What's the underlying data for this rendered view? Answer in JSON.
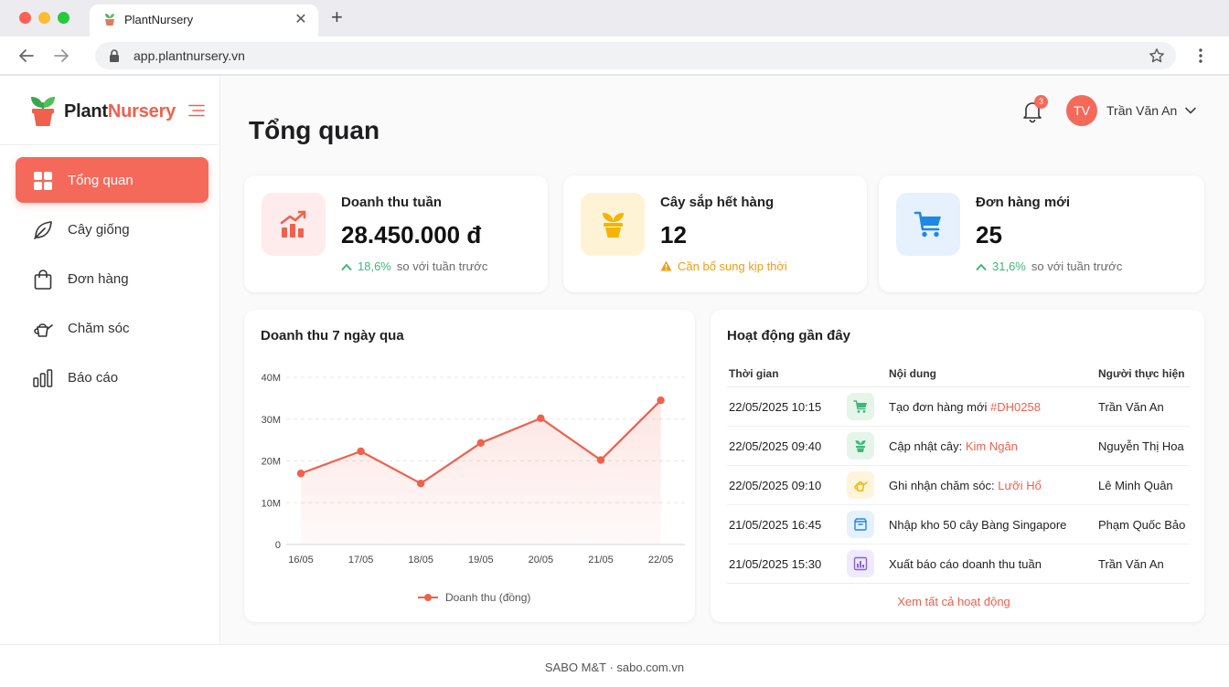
{
  "browser": {
    "tab_title": "PlantNursery",
    "url": "app.plantnursery.vn"
  },
  "brand": {
    "part1": "Plant",
    "part2": "Nursery",
    "accent_color": "#f0604d"
  },
  "sidebar": {
    "items": [
      {
        "label": "Tổng quan",
        "icon": "dashboard-grid-icon",
        "active": true
      },
      {
        "label": "Cây giống",
        "icon": "leaf-icon",
        "active": false
      },
      {
        "label": "Đơn hàng",
        "icon": "shopping-bag-icon",
        "active": false
      },
      {
        "label": "Chăm sóc",
        "icon": "watering-can-icon",
        "active": false
      },
      {
        "label": "Báo cáo",
        "icon": "bar-chart-icon",
        "active": false
      }
    ]
  },
  "header": {
    "page_title": "Tổng quan",
    "notification_count": "3",
    "avatar_initials": "TV",
    "user_name": "Trần Văn An"
  },
  "stats": [
    {
      "title": "Doanh thu tuần",
      "value": "28.450.000 đ",
      "change": "18,6%",
      "note": "so với tuần trước",
      "icon": "trending-up-chart-icon",
      "color": "#f0604d"
    },
    {
      "title": "Cây sắp hết hàng",
      "value": "12",
      "warning": "Cần bổ sung kịp thời",
      "icon": "potted-plant-icon",
      "color": "#f5b400"
    },
    {
      "title": "Đơn hàng mới",
      "value": "25",
      "change": "31,6%",
      "note": "so với tuần trước",
      "icon": "shopping-cart-icon",
      "color": "#1e88e5"
    }
  ],
  "revenue_chart": {
    "title": "Doanh thu 7 ngày qua",
    "legend": "Doanh thu (đồng)",
    "y_ticks": [
      "40M",
      "30M",
      "20M",
      "10M",
      "0"
    ]
  },
  "chart_data": {
    "type": "area",
    "title": "Doanh thu 7 ngày qua",
    "categories": [
      "16/05",
      "17/05",
      "18/05",
      "19/05",
      "20/05",
      "21/05",
      "22/05"
    ],
    "series": [
      {
        "name": "Doanh thu (đồng)",
        "values": [
          17,
          22.3,
          14.6,
          24.3,
          30.2,
          20.2,
          34.5
        ],
        "unit": "M"
      }
    ],
    "ylim": [
      0,
      40
    ],
    "grid": true,
    "legend_position": "bottom",
    "color": "#f0604d"
  },
  "activity": {
    "title": "Hoạt động gần đây",
    "headers": [
      "Thời gian",
      "Nội dung",
      "Người thực hiện"
    ],
    "rows": [
      {
        "time": "22/05/2025 10:15",
        "icon": "cart-icon",
        "text": "Tạo đơn hàng mới ",
        "highlight": "#DH0258",
        "user": "Trần Văn An"
      },
      {
        "time": "22/05/2025 09:40",
        "icon": "plant-icon",
        "text": "Cập nhật cây: ",
        "highlight": "Kim Ngân",
        "user": "Nguyễn Thị Hoa"
      },
      {
        "time": "22/05/2025 09:10",
        "icon": "watering-can-icon",
        "text": "Ghi nhận chăm sóc: ",
        "highlight": "Lưỡi Hổ",
        "user": "Lê Minh Quân"
      },
      {
        "time": "21/05/2025 16:45",
        "icon": "box-icon",
        "text": "Nhập kho 50 cây Bàng Singapore",
        "highlight": "",
        "user": "Phạm Quốc Bảo"
      },
      {
        "time": "21/05/2025 15:30",
        "icon": "report-icon",
        "text": "Xuất báo cáo doanh thu tuần",
        "highlight": "",
        "user": "Trần Văn An"
      }
    ],
    "view_all": "Xem tất cả hoạt động"
  },
  "footer": {
    "text": "SABO M&T · sabo.com.vn"
  }
}
